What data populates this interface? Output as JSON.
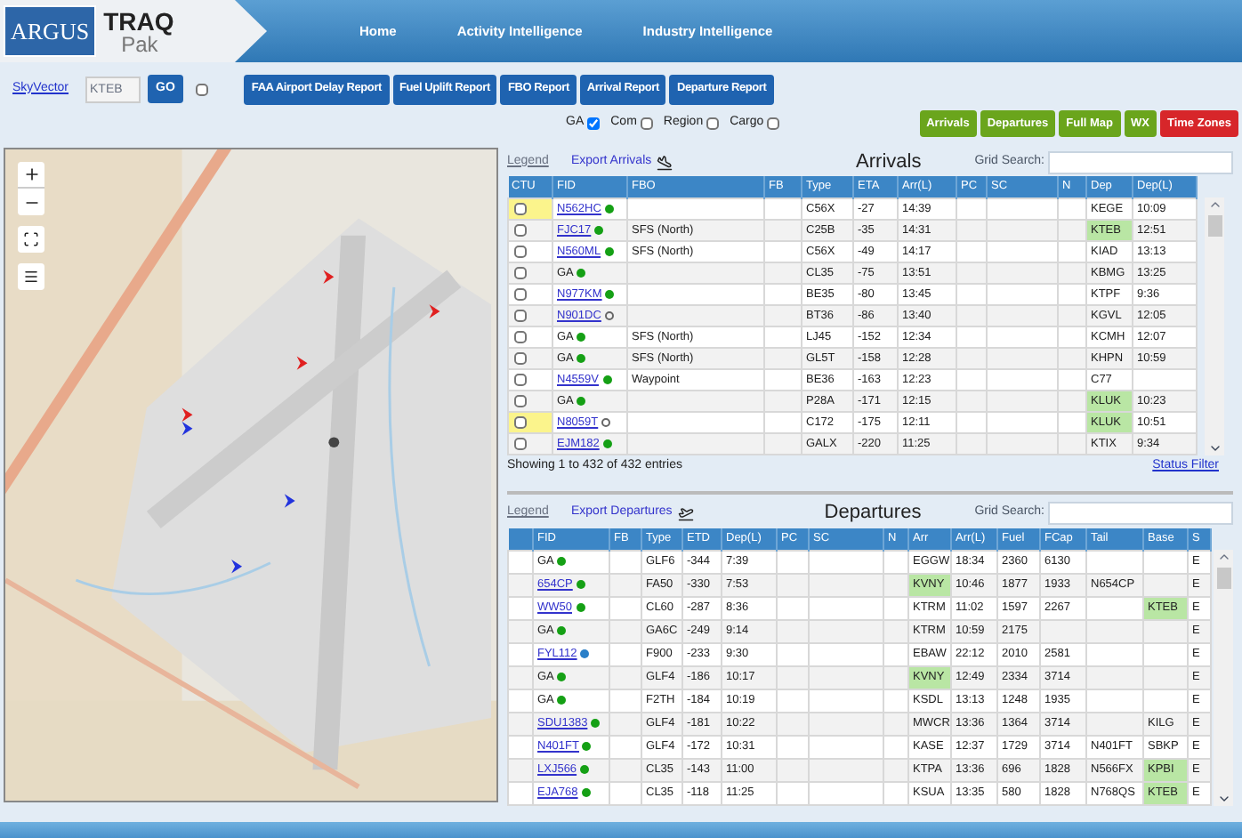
{
  "header": {
    "logo_left": "ARGUS",
    "logo_top": "TRAQ",
    "logo_bottom": "Pak",
    "nav": [
      {
        "label": "Home"
      },
      {
        "label": "Activity Intelligence"
      },
      {
        "label": "Industry Intelligence"
      }
    ]
  },
  "toolbar": {
    "link": "SkyVector",
    "airport_field": {
      "value": "KTEB"
    },
    "go_button": "GO",
    "toggle_checked": false,
    "reports": [
      "FAA Airport Delay Report",
      "Fuel Uplift Report",
      "FBO Report",
      "Arrival Report",
      "Departure Report"
    ]
  },
  "filters": [
    {
      "label": "GA",
      "checked": true
    },
    {
      "label": "Com",
      "checked": false
    },
    {
      "label": "Region",
      "checked": false
    },
    {
      "label": "Cargo",
      "checked": false
    }
  ],
  "view_buttons": [
    {
      "label": "Arrivals",
      "color": "#6aa51c"
    },
    {
      "label": "Departures",
      "color": "#6aa51c"
    },
    {
      "label": "Full Map",
      "color": "#6aa51c"
    },
    {
      "label": "WX",
      "color": "#6aa51c"
    },
    {
      "label": "Time Zones",
      "color": "#d7262a"
    }
  ],
  "arrivals": {
    "legend": "Legend",
    "export": "Export Arrivals",
    "title": "Arrivals",
    "search_label": "Grid Search:",
    "columns": [
      "CTU",
      "FID",
      "FBO",
      "FB",
      "Type",
      "ETA",
      "Arr(L)",
      "PC",
      "SC",
      "N",
      "Dep",
      "Dep(L)"
    ],
    "rows": [
      {
        "cells": [
          {
            "kind": "checkbox",
            "checked": false,
            "highlight": true
          },
          {
            "kind": "flight",
            "text": "N562HC",
            "link": true,
            "hollow": false,
            "color": "#15a015"
          },
          "",
          "",
          "C56X",
          "-27",
          "14:39",
          "",
          "",
          "",
          "KEGE",
          "10:09"
        ]
      },
      {
        "cells": [
          {
            "kind": "checkbox",
            "checked": false,
            "highlight": false
          },
          {
            "kind": "flight",
            "text": "FJC17",
            "link": true,
            "hollow": false,
            "color": "#15a015"
          },
          "SFS (North)",
          "",
          "C25B",
          "-35",
          "14:31",
          "",
          "",
          "",
          {
            "text": "KTEB",
            "highlight": true
          },
          "12:51"
        ]
      },
      {
        "cells": [
          {
            "kind": "checkbox",
            "checked": false,
            "highlight": false
          },
          {
            "kind": "flight",
            "text": "N560ML",
            "link": true,
            "hollow": false,
            "color": "#15a015"
          },
          "SFS (North)",
          "",
          "C56X",
          "-49",
          "14:17",
          "",
          "",
          "",
          "KIAD",
          "13:13"
        ]
      },
      {
        "cells": [
          {
            "kind": "checkbox",
            "checked": false,
            "highlight": false
          },
          {
            "kind": "flight",
            "text": "GA",
            "link": false,
            "hollow": false,
            "color": "#15a015"
          },
          "",
          "",
          "CL35",
          "-75",
          "13:51",
          "",
          "",
          "",
          "KBMG",
          "13:25"
        ]
      },
      {
        "cells": [
          {
            "kind": "checkbox",
            "checked": false,
            "highlight": false
          },
          {
            "kind": "flight",
            "text": "N977KM",
            "link": true,
            "hollow": false,
            "color": "#15a015"
          },
          "",
          "",
          "BE35",
          "-80",
          "13:45",
          "",
          "",
          "",
          "KTPF",
          "9:36"
        ]
      },
      {
        "cells": [
          {
            "kind": "checkbox",
            "checked": false,
            "highlight": false
          },
          {
            "kind": "flight",
            "text": "N901DC",
            "link": true,
            "hollow": true,
            "color": "#666666"
          },
          "",
          "",
          "BT36",
          "-86",
          "13:40",
          "",
          "",
          "",
          "KGVL",
          "12:05"
        ]
      },
      {
        "cells": [
          {
            "kind": "checkbox",
            "checked": false,
            "highlight": false
          },
          {
            "kind": "flight",
            "text": "GA",
            "link": false,
            "hollow": false,
            "color": "#15a015"
          },
          "SFS (North)",
          "",
          "LJ45",
          "-152",
          "12:34",
          "",
          "",
          "",
          "KCMH",
          "12:07"
        ]
      },
      {
        "cells": [
          {
            "kind": "checkbox",
            "checked": false,
            "highlight": false
          },
          {
            "kind": "flight",
            "text": "GA",
            "link": false,
            "hollow": false,
            "color": "#15a015"
          },
          "SFS (North)",
          "",
          "GL5T",
          "-158",
          "12:28",
          "",
          "",
          "",
          "KHPN",
          "10:59"
        ]
      },
      {
        "cells": [
          {
            "kind": "checkbox",
            "checked": false,
            "highlight": false
          },
          {
            "kind": "flight",
            "text": "N4559V",
            "link": true,
            "hollow": false,
            "color": "#15a015"
          },
          "Waypoint",
          "",
          "BE36",
          "-163",
          "12:23",
          "",
          "",
          "",
          "C77",
          ""
        ]
      },
      {
        "cells": [
          {
            "kind": "checkbox",
            "checked": false,
            "highlight": false
          },
          {
            "kind": "flight",
            "text": "GA",
            "link": false,
            "hollow": false,
            "color": "#15a015"
          },
          "",
          "",
          "P28A",
          "-171",
          "12:15",
          "",
          "",
          "",
          {
            "text": "KLUK",
            "highlight": true
          },
          "10:23"
        ]
      },
      {
        "cells": [
          {
            "kind": "checkbox",
            "checked": false,
            "highlight": true
          },
          {
            "kind": "flight",
            "text": "N8059T",
            "link": true,
            "hollow": true,
            "color": "#666666"
          },
          "",
          "",
          "C172",
          "-175",
          "12:11",
          "",
          "",
          "",
          {
            "text": "KLUK",
            "highlight": true
          },
          "10:51"
        ]
      },
      {
        "cells": [
          {
            "kind": "checkbox",
            "checked": false,
            "highlight": false
          },
          {
            "kind": "flight",
            "text": "EJM182",
            "link": true,
            "hollow": false,
            "color": "#15a015"
          },
          "",
          "",
          "GALX",
          "-220",
          "11:25",
          "",
          "",
          "",
          "KTIX",
          "9:34"
        ]
      }
    ],
    "showing": "Showing 1 to 432 of 432 entries",
    "status_filter": "Status Filter"
  },
  "departures": {
    "legend": "Legend",
    "export": "Export Departures",
    "title": "Departures",
    "search_label": "Grid Search:",
    "columns": [
      "FID",
      "FB",
      "Type",
      "ETD",
      "Dep(L)",
      "PC",
      "SC",
      "N",
      "Arr",
      "Arr(L)",
      "Fuel",
      "FCap",
      "Tail",
      "Base",
      "S"
    ],
    "rows": [
      {
        "cells": [
          {
            "kind": "flight",
            "text": "GA",
            "link": false,
            "hollow": false,
            "color": "#15a015"
          },
          "",
          "GLF6",
          "-344",
          "7:39",
          "",
          "",
          "",
          "EGGW",
          "18:34",
          "2360",
          "6130",
          "",
          "",
          "E"
        ]
      },
      {
        "cells": [
          {
            "kind": "flight",
            "text": "654CP",
            "link": true,
            "hollow": false,
            "color": "#15a015"
          },
          "",
          "FA50",
          "-330",
          "7:53",
          "",
          "",
          "",
          {
            "text": "KVNY",
            "highlight": true
          },
          "10:46",
          "1877",
          "1933",
          "N654CP",
          "",
          "E"
        ]
      },
      {
        "cells": [
          {
            "kind": "flight",
            "text": "WW50",
            "link": true,
            "hollow": false,
            "color": "#15a015"
          },
          "",
          "CL60",
          "-287",
          "8:36",
          "",
          "",
          "",
          "KTRM",
          "11:02",
          "1597",
          "2267",
          "",
          {
            "text": "KTEB",
            "highlight": true
          },
          "E"
        ]
      },
      {
        "cells": [
          {
            "kind": "flight",
            "text": "GA",
            "link": false,
            "hollow": false,
            "color": "#15a015"
          },
          "",
          "GA6C",
          "-249",
          "9:14",
          "",
          "",
          "",
          "KTRM",
          "10:59",
          "2175",
          "",
          "",
          "",
          "E"
        ]
      },
      {
        "cells": [
          {
            "kind": "flight",
            "text": "FYL112",
            "link": true,
            "hollow": false,
            "color": "#2a7fc8"
          },
          "",
          "F900",
          "-233",
          "9:30",
          "",
          "",
          "",
          "EBAW",
          "22:12",
          "2010",
          "2581",
          "",
          "",
          "E"
        ]
      },
      {
        "cells": [
          {
            "kind": "flight",
            "text": "GA",
            "link": false,
            "hollow": false,
            "color": "#15a015"
          },
          "",
          "GLF4",
          "-186",
          "10:17",
          "",
          "",
          "",
          {
            "text": "KVNY",
            "highlight": true
          },
          "12:49",
          "2334",
          "3714",
          "",
          "",
          "E"
        ]
      },
      {
        "cells": [
          {
            "kind": "flight",
            "text": "GA",
            "link": false,
            "hollow": false,
            "color": "#15a015"
          },
          "",
          "F2TH",
          "-184",
          "10:19",
          "",
          "",
          "",
          "KSDL",
          "13:13",
          "1248",
          "1935",
          "",
          "",
          "E"
        ]
      },
      {
        "cells": [
          {
            "kind": "flight",
            "text": "SDU1383",
            "link": true,
            "hollow": false,
            "color": "#15a015"
          },
          "",
          "GLF4",
          "-181",
          "10:22",
          "",
          "",
          "",
          "MWCR",
          "13:36",
          "1364",
          "3714",
          "",
          "KILG",
          "E"
        ]
      },
      {
        "cells": [
          {
            "kind": "flight",
            "text": "N401FT",
            "link": true,
            "hollow": false,
            "color": "#15a015"
          },
          "",
          "GLF4",
          "-172",
          "10:31",
          "",
          "",
          "",
          "KASE",
          "12:37",
          "1729",
          "3714",
          "N401FT",
          "SBKP",
          "E"
        ]
      },
      {
        "cells": [
          {
            "kind": "flight",
            "text": "LXJ566",
            "link": true,
            "hollow": false,
            "color": "#15a015"
          },
          "",
          "CL35",
          "-143",
          "11:00",
          "",
          "",
          "",
          "KTPA",
          "13:36",
          "696",
          "1828",
          "N566FX",
          {
            "text": "KPBI",
            "highlight": true
          },
          "E"
        ]
      },
      {
        "cells": [
          {
            "kind": "flight",
            "text": "EJA768",
            "link": true,
            "hollow": false,
            "color": "#15a015"
          },
          "",
          "CL35",
          "-118",
          "11:25",
          "",
          "",
          "",
          "KSUA",
          "13:35",
          "580",
          "1828",
          "N768QS",
          {
            "text": "KTEB",
            "highlight": true
          },
          "E"
        ]
      }
    ]
  }
}
